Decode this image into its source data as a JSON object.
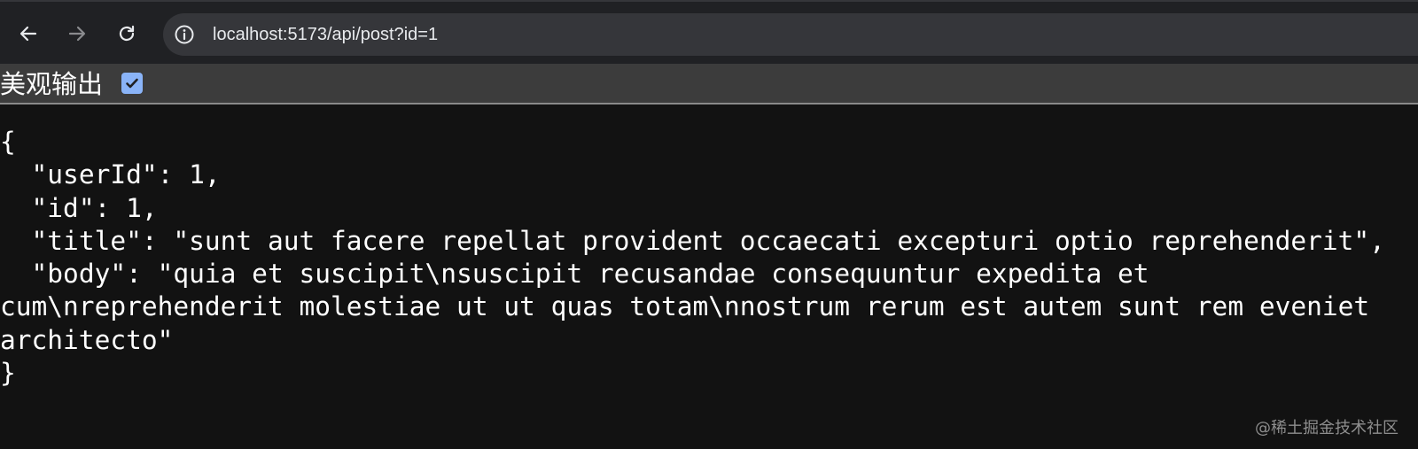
{
  "browser": {
    "url": "localhost:5173/api/post?id=1",
    "icons": {
      "back": "arrow-left-icon",
      "forward": "arrow-right-icon",
      "reload": "reload-icon",
      "site_info": "info-icon"
    }
  },
  "toolbar": {
    "pretty_print_label": "美观输出",
    "pretty_print_checked": true
  },
  "json_output": "{\n  \"userId\": 1,\n  \"id\": 1,\n  \"title\": \"sunt aut facere repellat provident occaecati excepturi optio reprehenderit\",\n  \"body\": \"quia et suscipit\\nsuscipit recusandae consequuntur expedita et cum\\nreprehenderit molestiae ut ut quas totam\\nnostrum rerum est autem sunt rem eveniet architecto\"\n}",
  "watermark": "@稀土掘金技术社区",
  "colors": {
    "page_background": "#121212",
    "browser_bar": "#202124",
    "address_bar": "#35363a",
    "toolbar": "#3c3c3c",
    "checkbox_accent": "#8ab4f8",
    "text": "#ffffff"
  }
}
